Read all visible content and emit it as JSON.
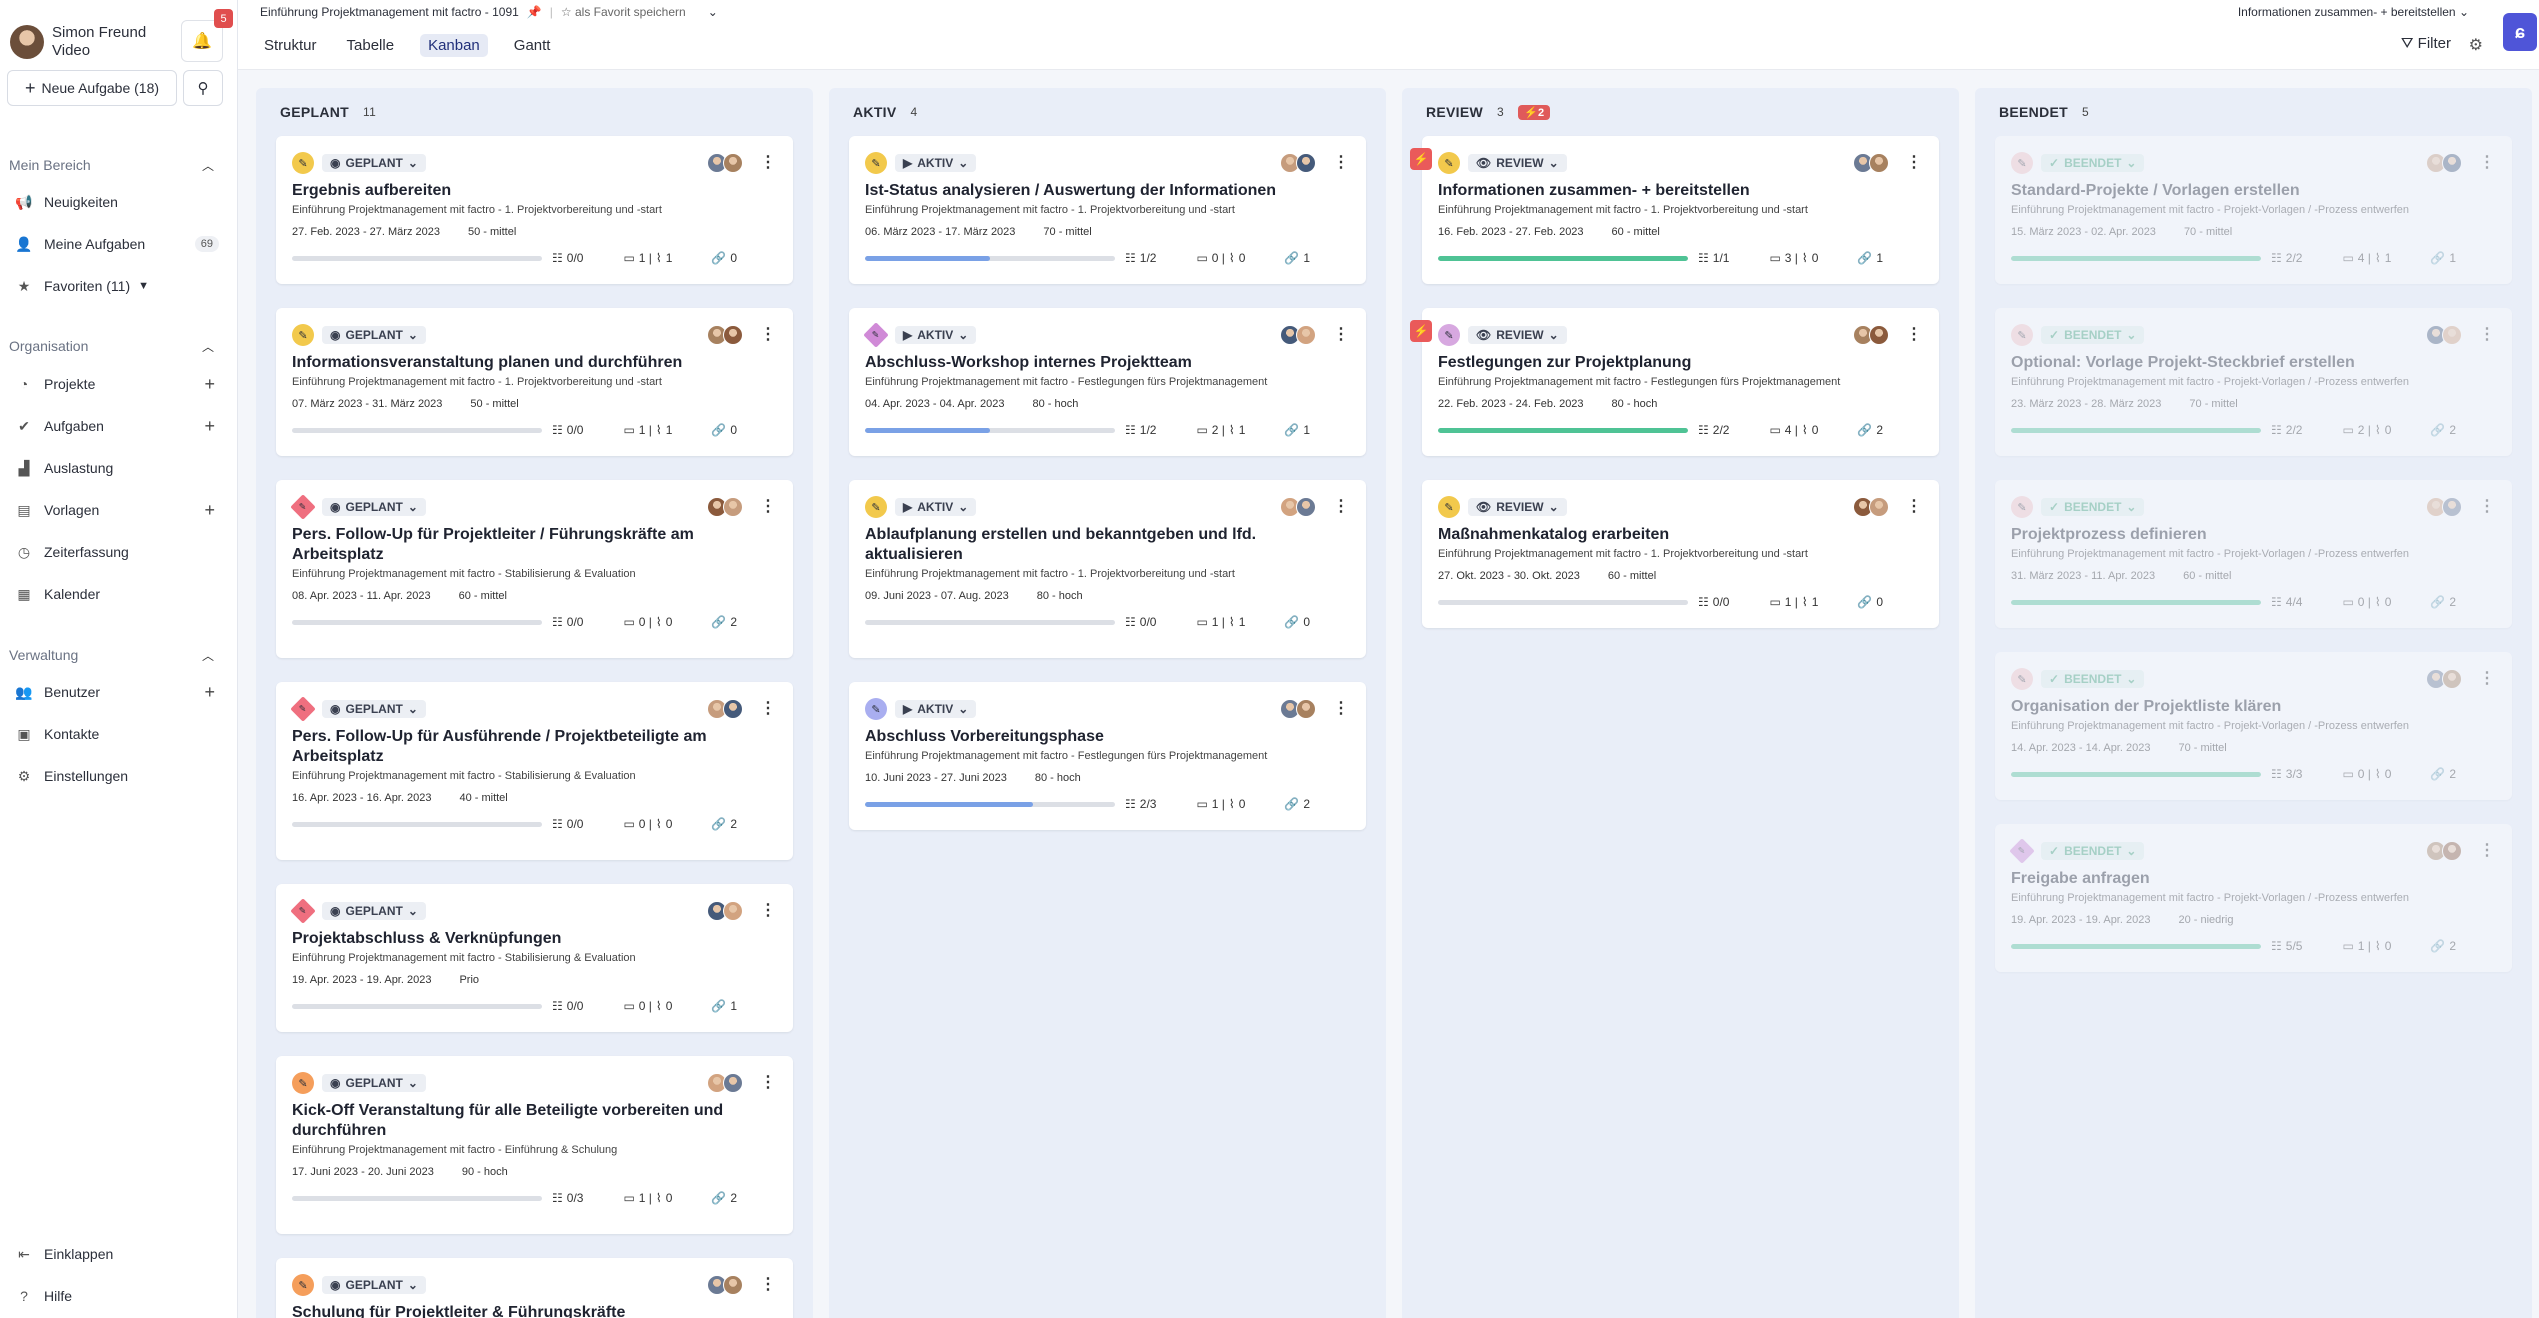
{
  "user": {
    "name": "Simon Freund",
    "role": "Video"
  },
  "notifications": {
    "count": "5"
  },
  "sidebar": {
    "new_task": "Neue Aufgabe (18)",
    "mein_bereich": "Mein Bereich",
    "neuigkeiten": "Neuigkeiten",
    "meine_aufgaben": "Meine Aufgaben",
    "meine_aufgaben_count": "69",
    "favoriten": "Favoriten (11)",
    "organisation": "Organisation",
    "projekte": "Projekte",
    "aufgaben": "Aufgaben",
    "auslastung": "Auslastung",
    "vorlagen": "Vorlagen",
    "zeiterfassung": "Zeiterfassung",
    "kalender": "Kalender",
    "verwaltung": "Verwaltung",
    "benutzer": "Benutzer",
    "kontakte": "Kontakte",
    "einstellungen": "Einstellungen",
    "einklappen": "Einklappen",
    "hilfe": "Hilfe"
  },
  "header": {
    "breadcrumb": "Einführung Projektmanagement mit factro - 1091",
    "favorite": "als Favorit speichern",
    "right_label": "Informationen zusammen- + bereitstellen",
    "filter": "Filter",
    "tabs": [
      "Struktur",
      "Tabelle",
      "Kanban",
      "Gantt"
    ]
  },
  "columns": [
    {
      "name": "GEPLANT",
      "count": "11",
      "extra": "",
      "cards": [
        {
          "status": "GEPLANT",
          "title": "Ergebnis aufbereiten",
          "sub": "Einführung Projektmanagement mit factro - 1. Projektvorbereitung und -start",
          "dates": "27. Feb. 2023 - 27. März 2023",
          "effort": "50 - mittel",
          "checks": "0/0",
          "comments": "1 | ",
          "attach": "1",
          "links": "0",
          "progress": 0
        },
        {
          "status": "GEPLANT",
          "title": "Informationsveranstaltung planen und durchführen",
          "sub": "Einführung Projektmanagement mit factro - 1. Projektvorbereitung und -start",
          "dates": "07. März 2023 - 31. März 2023",
          "effort": "50 - mittel",
          "checks": "0/0",
          "comments": "1 | ",
          "attach": "1",
          "links": "0",
          "progress": 0
        },
        {
          "status": "GEPLANT",
          "title": "Pers. Follow-Up für Projektleiter / Führungskräfte am Arbeitsplatz",
          "sub": "Einführung Projektmanagement mit factro - Stabilisierung & Evaluation",
          "dates": "08. Apr. 2023 - 11. Apr. 2023",
          "effort": "60 - mittel",
          "checks": "0/0",
          "comments": "0 | ",
          "attach": "0",
          "links": "2",
          "progress": 0
        },
        {
          "status": "GEPLANT",
          "title": "Pers. Follow-Up für Ausführende / Projektbeteiligte am Arbeitsplatz",
          "sub": "Einführung Projektmanagement mit factro - Stabilisierung & Evaluation",
          "dates": "16. Apr. 2023 - 16. Apr. 2023",
          "effort": "40 - mittel",
          "checks": "0/0",
          "comments": "0 | ",
          "attach": "0",
          "links": "2",
          "progress": 0
        },
        {
          "status": "GEPLANT",
          "title": "Projektabschluss & Verknüpfungen",
          "sub": "Einführung Projektmanagement mit factro - Stabilisierung & Evaluation",
          "dates": "19. Apr. 2023 - 19. Apr. 2023",
          "effort": "Prio",
          "checks": "0/0",
          "comments": "0 | ",
          "attach": "0",
          "links": "1",
          "progress": 0
        },
        {
          "status": "GEPLANT",
          "title": "Kick-Off Veranstaltung für alle Beteiligte vorbereiten und durchführen",
          "sub": "Einführung Projektmanagement mit factro - Einführung & Schulung",
          "dates": "17. Juni 2023 - 20. Juni 2023",
          "effort": "90 - hoch",
          "checks": "0/3",
          "comments": "1 | ",
          "attach": "0",
          "links": "2",
          "progress": 0
        },
        {
          "status": "GEPLANT",
          "title": "Schulung für Projektleiter & Führungskräfte",
          "sub": "",
          "dates": "",
          "effort": "",
          "checks": "",
          "comments": "",
          "attach": "",
          "links": "",
          "progress": 0
        }
      ]
    },
    {
      "name": "AKTIV",
      "count": "4",
      "extra": "",
      "cards": [
        {
          "status": "AKTIV",
          "title": "Ist-Status analysieren / Auswertung der Informationen",
          "sub": "Einführung Projektmanagement mit factro - 1. Projektvorbereitung und -start",
          "dates": "06. März 2023 - 17. März 2023",
          "effort": "70 - mittel",
          "checks": "1/2",
          "comments": "0 | ",
          "attach": "0",
          "links": "1",
          "progress": 0.5
        },
        {
          "status": "AKTIV",
          "title": "Abschluss-Workshop internes Projektteam",
          "sub": "Einführung Projektmanagement mit factro - Festlegungen fürs Projektmanagement",
          "dates": "04. Apr. 2023 - 04. Apr. 2023",
          "effort": "80 - hoch",
          "checks": "1/2",
          "comments": "2 | ",
          "attach": "1",
          "links": "1",
          "progress": 0.5
        },
        {
          "status": "AKTIV",
          "title": "Ablaufplanung erstellen und bekanntgeben und lfd. aktualisieren",
          "sub": "Einführung Projektmanagement mit factro - 1. Projektvorbereitung und -start",
          "dates": "09. Juni 2023 - 07. Aug. 2023",
          "effort": "80 - hoch",
          "checks": "0/0",
          "comments": "1 | ",
          "attach": "1",
          "links": "0",
          "progress": 0
        },
        {
          "status": "AKTIV",
          "title": "Abschluss Vorbereitungsphase",
          "sub": "Einführung Projektmanagement mit factro - Festlegungen fürs Projektmanagement",
          "dates": "10. Juni 2023 - 27. Juni 2023",
          "effort": "80 - hoch",
          "checks": "2/3",
          "comments": "1 | ",
          "attach": "0",
          "links": "2",
          "progress": 0.67
        }
      ]
    },
    {
      "name": "REVIEW",
      "count": "3",
      "extra": "2",
      "cards": [
        {
          "status": "REVIEW",
          "title": "Informationen zusammen- + bereitstellen",
          "sub": "Einführung Projektmanagement mit factro - 1. Projektvorbereitung und -start",
          "dates": "16. Feb. 2023 - 27. Feb. 2023",
          "effort": "60 - mittel",
          "checks": "1/1",
          "comments": "3 | ",
          "attach": "0",
          "links": "1",
          "progress": 1
        },
        {
          "status": "REVIEW",
          "title": "Festlegungen zur Projektplanung",
          "sub": "Einführung Projektmanagement mit factro - Festlegungen fürs Projektmanagement",
          "dates": "22. Feb. 2023 - 24. Feb. 2023",
          "effort": "80 - hoch",
          "checks": "2/2",
          "comments": "4 | ",
          "attach": "0",
          "links": "2",
          "progress": 1
        },
        {
          "status": "REVIEW",
          "title": "Maßnahmenkatalog erarbeiten",
          "sub": "Einführung Projektmanagement mit factro - 1. Projektvorbereitung und -start",
          "dates": "27. Okt. 2023 - 30. Okt. 2023",
          "effort": "60 - mittel",
          "checks": "0/0",
          "comments": "1 | ",
          "attach": "1",
          "links": "0",
          "progress": 0
        }
      ]
    },
    {
      "name": "BEENDET",
      "count": "5",
      "extra": "",
      "cards": [
        {
          "status": "BEENDET",
          "title": "Standard-Projekte / Vorlagen erstellen",
          "sub": "Einführung Projektmanagement mit factro - Projekt-Vorlagen / -Prozess entwerfen",
          "dates": "15. März 2023 - 02. Apr. 2023",
          "effort": "70 - mittel",
          "checks": "2/2",
          "comments": "4 | ",
          "attach": "1",
          "links": "1",
          "progress": 1
        },
        {
          "status": "BEENDET",
          "title": "Optional: Vorlage Projekt-Steckbrief erstellen",
          "sub": "Einführung Projektmanagement mit factro - Projekt-Vorlagen / -Prozess entwerfen",
          "dates": "23. März 2023 - 28. März 2023",
          "effort": "70 - mittel",
          "checks": "2/2",
          "comments": "2 | ",
          "attach": "0",
          "links": "2",
          "progress": 1
        },
        {
          "status": "BEENDET",
          "title": "Projektprozess definieren",
          "sub": "Einführung Projektmanagement mit factro - Projekt-Vorlagen / -Prozess entwerfen",
          "dates": "31. März 2023 - 11. Apr. 2023",
          "effort": "60 - mittel",
          "checks": "4/4",
          "comments": "0 | ",
          "attach": "0",
          "links": "2",
          "progress": 1
        },
        {
          "status": "BEENDET",
          "title": "Organisation der Projektliste klären",
          "sub": "Einführung Projektmanagement mit factro - Projekt-Vorlagen / -Prozess entwerfen",
          "dates": "14. Apr. 2023 - 14. Apr. 2023",
          "effort": "70 - mittel",
          "checks": "3/3",
          "comments": "0 | ",
          "attach": "0",
          "links": "2",
          "progress": 1
        },
        {
          "status": "BEENDET",
          "title": "Freigabe anfragen",
          "sub": "Einführung Projektmanagement mit factro - Projekt-Vorlagen / -Prozess entwerfen",
          "dates": "19. Apr. 2023 - 19. Apr. 2023",
          "effort": "20 - niedrig",
          "checks": "5/5",
          "comments": "1 | ",
          "attach": "0",
          "links": "2",
          "progress": 1
        }
      ]
    }
  ]
}
